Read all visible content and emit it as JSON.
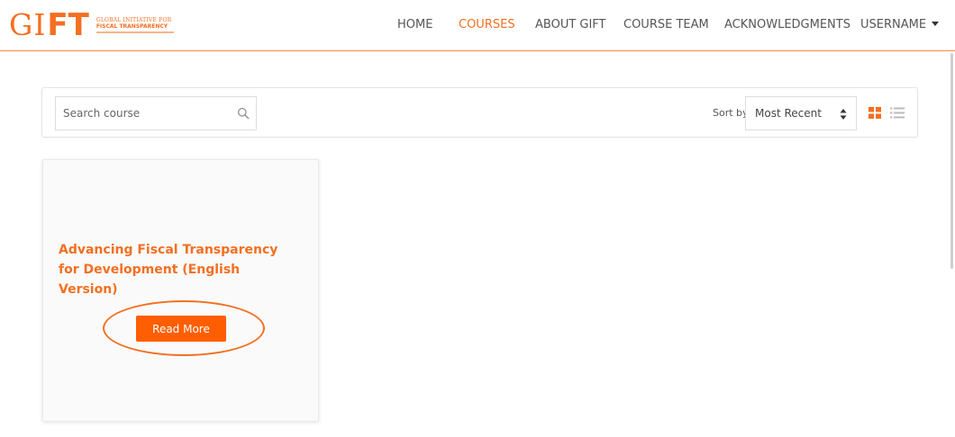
{
  "header": {
    "logo": {
      "mark_gi": "GI",
      "mark_ft": "FT",
      "line1": "GLOBAL INITIATIVE FOR",
      "line2": "FISCAL TRANSPARENCY"
    },
    "nav": [
      {
        "label": "HOME",
        "active": false
      },
      {
        "label": "COURSES",
        "active": true
      },
      {
        "label": "ABOUT GIFT",
        "active": false
      },
      {
        "label": "COURSE TEAM",
        "active": false
      },
      {
        "label": "ACKNOWLEDGMENTS",
        "active": false
      },
      {
        "label": "USERNAME",
        "active": false
      }
    ]
  },
  "toolbar": {
    "search_placeholder": "Search course",
    "sort_label": "Sort by",
    "sort_value": "Most Recent",
    "view_modes": [
      "grid-view-icon",
      "list-view-icon"
    ],
    "active_view": "grid"
  },
  "courses": [
    {
      "title": "Advancing Fiscal Transparency for Development (English Version)",
      "button_label": "Read More"
    }
  ],
  "colors": {
    "accent": "#f36f21",
    "button": "#ff5e00",
    "text": "#555555"
  }
}
